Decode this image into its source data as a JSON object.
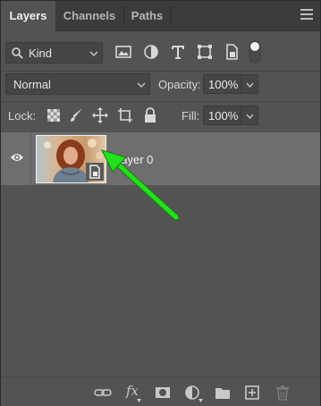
{
  "tabs": [
    {
      "label": "Layers",
      "active": true
    },
    {
      "label": "Channels",
      "active": false
    },
    {
      "label": "Paths",
      "active": false
    }
  ],
  "filter": {
    "kind_label": "Kind",
    "filter_icons": [
      "image-filter-icon",
      "adjustment-filter-icon",
      "type-filter-icon",
      "shape-filter-icon",
      "smart-object-filter-icon",
      "filter-toggle-icon"
    ]
  },
  "blend": {
    "mode": "Normal",
    "opacity_label": "Opacity:",
    "opacity_value": "100%"
  },
  "lock": {
    "label": "Lock:",
    "icons": [
      "lock-transparent-pixels-icon",
      "lock-image-pixels-icon",
      "lock-position-icon",
      "lock-artboard-icon",
      "lock-all-icon"
    ],
    "fill_label": "Fill:",
    "fill_value": "100%"
  },
  "layers": [
    {
      "name": "Layer 0",
      "visible": true,
      "smart_object": true,
      "selected": true
    }
  ],
  "bottom_icons": [
    "link-layers-icon",
    "fx-icon",
    "layer-mask-icon",
    "adjustment-layer-icon",
    "group-folder-icon",
    "new-layer-icon",
    "trash-icon"
  ],
  "bottom_fx_label": "fx",
  "colors": {
    "panel": "#535353",
    "selected_row": "#6e6e6e",
    "annotation_arrow": "#22e01c"
  }
}
